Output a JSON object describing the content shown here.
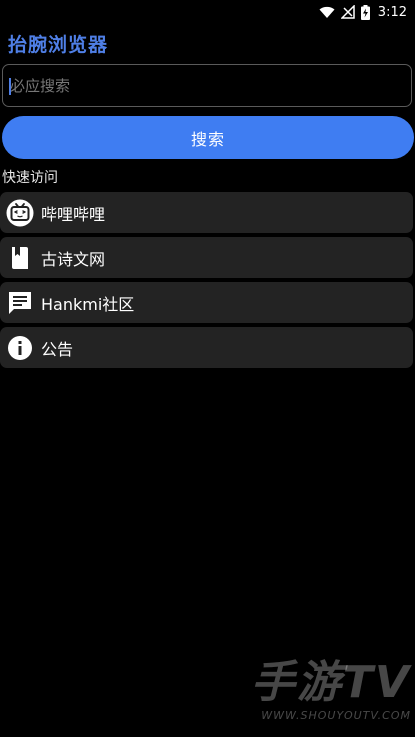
{
  "status_bar": {
    "time": "3:12",
    "icons": [
      "wifi-icon",
      "no-signal-icon",
      "battery-charging-icon"
    ]
  },
  "app": {
    "title": "抬腕浏览器"
  },
  "search": {
    "placeholder": "必应搜索",
    "value": "",
    "button_label": "搜索"
  },
  "quick_access": {
    "title": "快速访问",
    "items": [
      {
        "label": "哔哩哔哩",
        "icon": "tv-icon"
      },
      {
        "label": "古诗文网",
        "icon": "book-icon"
      },
      {
        "label": "Hankmi社区",
        "icon": "chat-icon"
      },
      {
        "label": "公告",
        "icon": "info-icon"
      }
    ]
  },
  "watermark": {
    "brand": "手游TV",
    "url": "WWW.SHOUYOUTV.COM"
  },
  "colors": {
    "accent": "#3f7df2",
    "title": "#4f7fe6",
    "background": "#000000",
    "card": "#232323"
  }
}
